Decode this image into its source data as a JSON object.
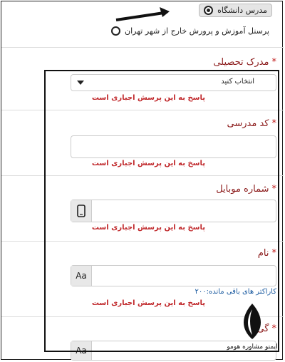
{
  "options": [
    {
      "label": "مدرس دانشگاه",
      "checked": true
    },
    {
      "label": "پرسنل آموزش و پرورش خارج از شهر تهران",
      "checked": false
    }
  ],
  "fields": {
    "degree": {
      "label": "مدرک تحصیلی",
      "value": "انتخاب کنید",
      "error": "پاسخ به این پرسش اجباری است"
    },
    "school_code": {
      "label": "کد مدرسی",
      "error": "پاسخ به این پرسش اجباری است"
    },
    "mobile": {
      "label": "شماره موبایل",
      "error": "پاسخ به این پرسش اجباری است"
    },
    "name": {
      "label": "نام",
      "addon": "Aa",
      "counter": "کاراکتر های باقی مانده:۲۰۰",
      "error": "پاسخ به این پرسش اجباری است"
    },
    "last": {
      "label": "گی",
      "addon": "Aa"
    }
  },
  "watermark": "ایمنو مشاوره هومو"
}
